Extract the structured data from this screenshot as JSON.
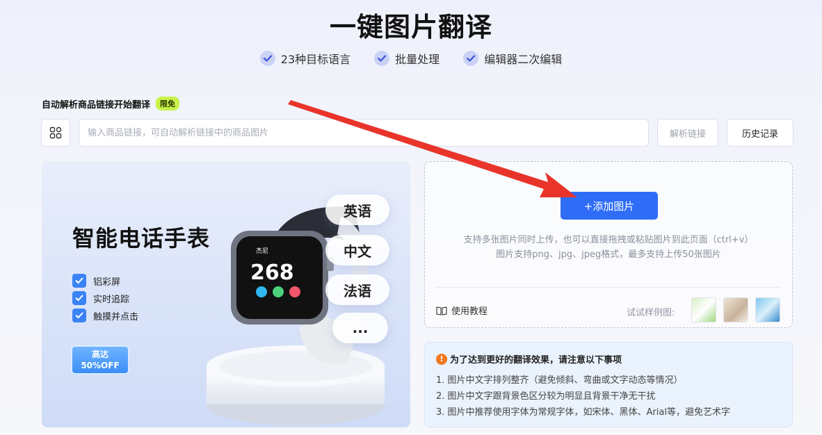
{
  "header": {
    "title": "一键图片翻译",
    "features": [
      "23种目标语言",
      "批量处理",
      "编辑器二次编辑"
    ]
  },
  "link_section": {
    "label": "自动解析商品链接开始翻译",
    "badge": "限免",
    "input_placeholder": "输入商品链接，可自动解析链接中的商品图片",
    "parse_button": "解析链接",
    "history_button": "历史记录"
  },
  "banner": {
    "title": "智能电话手表",
    "features": [
      "铝彩屏",
      "实时追踪",
      "触摸并点击"
    ],
    "promo_line1": "高达",
    "promo_line2": "50%OFF",
    "languages": [
      "英语",
      "中文",
      "法语",
      "..."
    ],
    "watch_brand": "杰尼",
    "watch_number": "268"
  },
  "upload": {
    "add_button": "+添加图片",
    "hint_line1": "支持多张图片同时上传，也可以直接拖拽或粘贴图片到此页面（ctrl+v）",
    "hint_line2": "图片支持png、jpg、jpeg格式，最多支持上传50张图片",
    "tutorial": "使用教程",
    "samples_label": "试试样例图:"
  },
  "notice": {
    "title": "为了达到更好的翻译效果，请注意以下事项",
    "items": [
      "1. 图片中文字排列整齐（避免倾斜、弯曲或文字动态等情况）",
      "2. 图片中文字跟背景色区分较为明显且背景干净无干扰",
      "3. 图片中推荐使用字体为常规字体，如宋体、黑体、Arial等，避免艺术字"
    ]
  },
  "colors": {
    "primary": "#2f6df6",
    "arrow": "#e8342b",
    "badge": "#c9f24a"
  }
}
